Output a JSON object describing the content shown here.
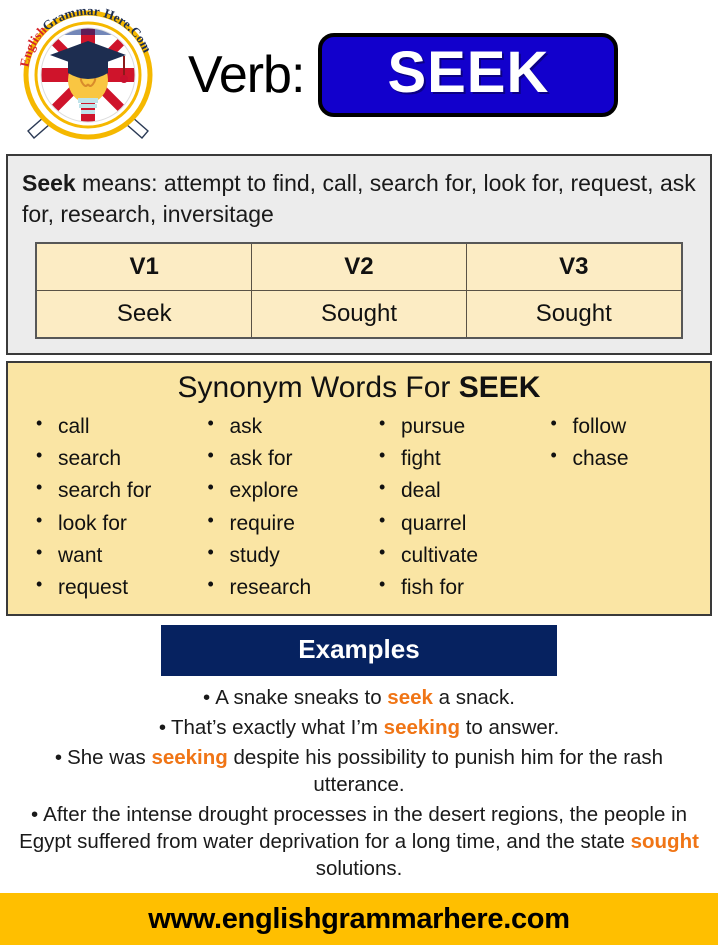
{
  "brand": {
    "logo_alt": "English Grammar Here.Com",
    "logo_ring_text": "English Grammar Here.Com"
  },
  "header": {
    "verb_label": "Verb:",
    "verb_word": "SEEK"
  },
  "definition": {
    "lead_word": "Seek",
    "rest": " means: attempt to find, call, search for, look for, request, ask for, research, inversitage",
    "full_text": "Seek means: attempt to find, call, search for, look for, request, ask for, research, inversitage"
  },
  "forms_table": {
    "headers": [
      "V1",
      "V2",
      "V3"
    ],
    "values": [
      "Seek",
      "Sought",
      "Sought"
    ]
  },
  "synonyms": {
    "title_prefix": "Synonym Words For ",
    "title_word": "SEEK",
    "columns": [
      [
        "call",
        "search",
        "search for",
        "look for",
        "want",
        "request"
      ],
      [
        "ask",
        "ask for",
        "explore",
        "require",
        "study",
        "research"
      ],
      [
        "pursue",
        "fight",
        "deal",
        "quarrel",
        "cultivate",
        "fish for"
      ],
      [
        "follow",
        "chase"
      ]
    ]
  },
  "examples": {
    "heading": "Examples",
    "bullet": "•",
    "items": [
      {
        "pre": "A snake sneaks to ",
        "hl": "seek",
        "post": " a snack."
      },
      {
        "pre": "That’s exactly what I’m ",
        "hl": "seeking",
        "post": " to answer."
      },
      {
        "pre": "She was ",
        "hl": "seeking",
        "post": " despite his possibility to punish him for the rash utterance."
      },
      {
        "pre": "After the intense drought processes in the desert regions, the people in Egypt suffered from water deprivation for a long time, and the state ",
        "hl": "sought",
        "post": " solutions."
      }
    ]
  },
  "footer": {
    "url": "www.englishgrammarhere.com"
  },
  "colors": {
    "badge_blue": "#1200cc",
    "navy": "#062260",
    "gold": "#ffbf00",
    "orange": "#f07516",
    "panel_gray": "#ececec",
    "panel_yellow": "#fae5a4",
    "table_cream": "#fcecc4"
  }
}
